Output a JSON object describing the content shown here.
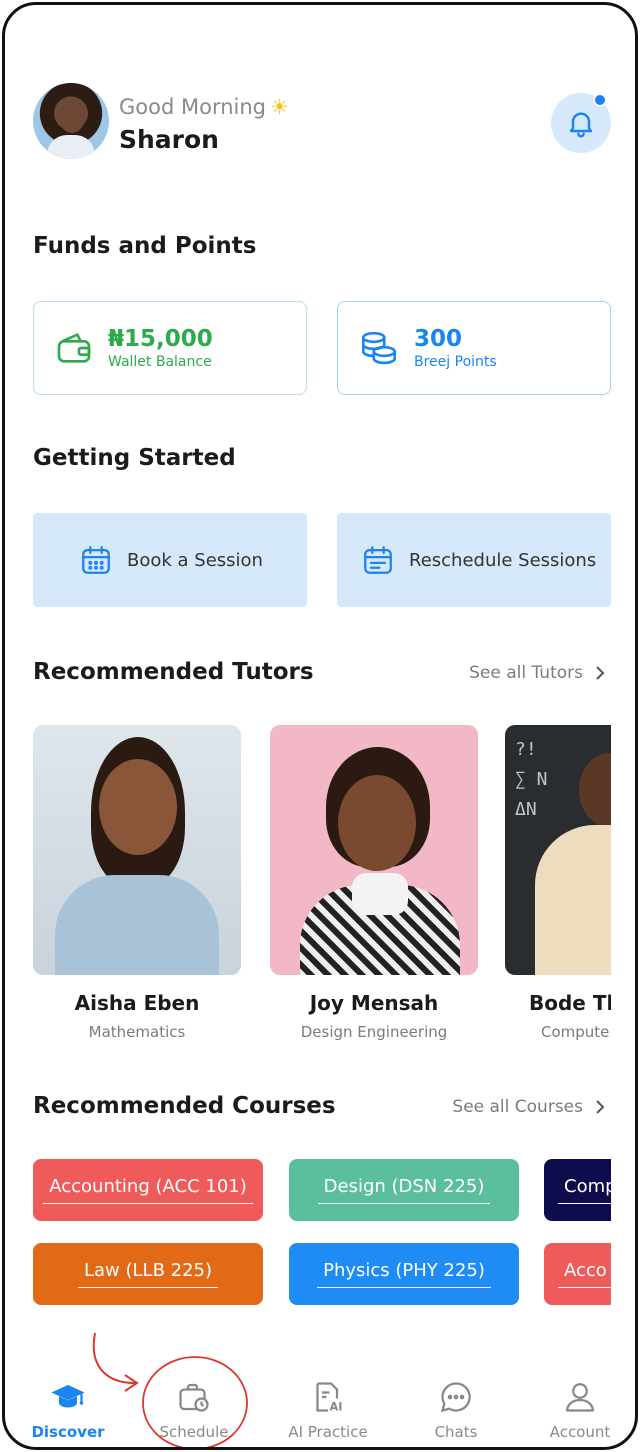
{
  "header": {
    "greeting": "Good Morning",
    "greeting_emoji": "☀",
    "user_name": "Sharon",
    "notification_dot": true
  },
  "funds": {
    "title": "Funds and Points",
    "wallet": {
      "value": "₦15,000",
      "label": "Wallet Balance",
      "icon": "wallet-icon",
      "color": "#2fa94e"
    },
    "points": {
      "value": "300",
      "label": "Breej Points",
      "icon": "coins-icon",
      "color": "#1a84f0"
    }
  },
  "getting_started": {
    "title": "Getting Started",
    "book": {
      "label": "Book a Session",
      "icon": "calendar-icon"
    },
    "reschedule": {
      "label": "Reschedule Sessions",
      "icon": "calendar-list-icon"
    }
  },
  "tutors": {
    "title": "Recommended Tutors",
    "see_all": "See all Tutors",
    "items": [
      {
        "name": "Aisha Eben",
        "subject": "Mathematics"
      },
      {
        "name": "Joy Mensah",
        "subject": "Design Engineering"
      },
      {
        "name": "Bode Th",
        "subject": "Compute"
      }
    ]
  },
  "courses": {
    "title": "Recommended Courses",
    "see_all": "See all Courses",
    "row1": [
      {
        "label": "Accounting (ACC 101)",
        "color": "#ef5a5a"
      },
      {
        "label": "Design (DSN 225)",
        "color": "#5bbf9f"
      },
      {
        "label": "Comp",
        "color": "#0f0c4d"
      }
    ],
    "row2": [
      {
        "label": "Law (LLB 225)",
        "color": "#e26a17"
      },
      {
        "label": "Physics (PHY 225)",
        "color": "#1f8cf5"
      },
      {
        "label": "Acco",
        "color": "#ef5a5a"
      }
    ]
  },
  "nav": {
    "items": [
      {
        "label": "Discover",
        "icon": "graduation-cap-icon",
        "active": true
      },
      {
        "label": "Schedule",
        "icon": "briefcase-clock-icon"
      },
      {
        "label": "AI Practice",
        "icon": "ai-document-icon"
      },
      {
        "label": "Chats",
        "icon": "chat-bubble-icon"
      },
      {
        "label": "Account",
        "icon": "user-icon"
      }
    ]
  },
  "colors": {
    "accent": "#1a84f0",
    "annotation": "#e0352b"
  }
}
